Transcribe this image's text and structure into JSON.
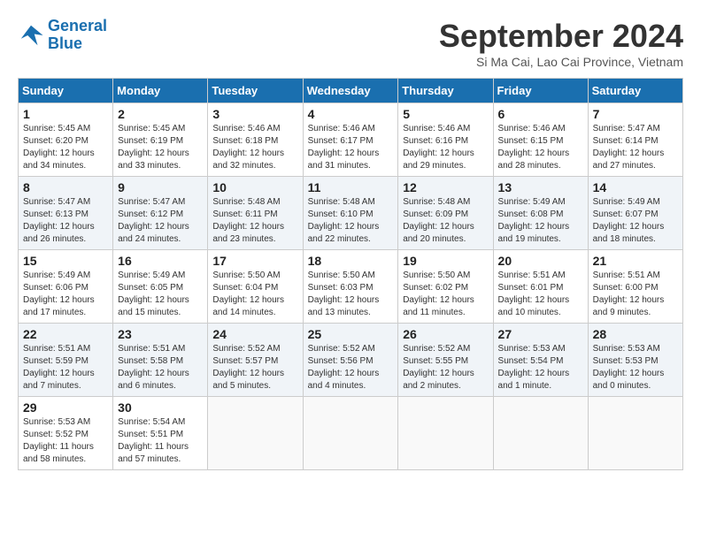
{
  "header": {
    "logo_line1": "General",
    "logo_line2": "Blue",
    "month": "September 2024",
    "location": "Si Ma Cai, Lao Cai Province, Vietnam"
  },
  "weekdays": [
    "Sunday",
    "Monday",
    "Tuesday",
    "Wednesday",
    "Thursday",
    "Friday",
    "Saturday"
  ],
  "weeks": [
    [
      {
        "day": "1",
        "info": "Sunrise: 5:45 AM\nSunset: 6:20 PM\nDaylight: 12 hours\nand 34 minutes."
      },
      {
        "day": "2",
        "info": "Sunrise: 5:45 AM\nSunset: 6:19 PM\nDaylight: 12 hours\nand 33 minutes."
      },
      {
        "day": "3",
        "info": "Sunrise: 5:46 AM\nSunset: 6:18 PM\nDaylight: 12 hours\nand 32 minutes."
      },
      {
        "day": "4",
        "info": "Sunrise: 5:46 AM\nSunset: 6:17 PM\nDaylight: 12 hours\nand 31 minutes."
      },
      {
        "day": "5",
        "info": "Sunrise: 5:46 AM\nSunset: 6:16 PM\nDaylight: 12 hours\nand 29 minutes."
      },
      {
        "day": "6",
        "info": "Sunrise: 5:46 AM\nSunset: 6:15 PM\nDaylight: 12 hours\nand 28 minutes."
      },
      {
        "day": "7",
        "info": "Sunrise: 5:47 AM\nSunset: 6:14 PM\nDaylight: 12 hours\nand 27 minutes."
      }
    ],
    [
      {
        "day": "8",
        "info": "Sunrise: 5:47 AM\nSunset: 6:13 PM\nDaylight: 12 hours\nand 26 minutes."
      },
      {
        "day": "9",
        "info": "Sunrise: 5:47 AM\nSunset: 6:12 PM\nDaylight: 12 hours\nand 24 minutes."
      },
      {
        "day": "10",
        "info": "Sunrise: 5:48 AM\nSunset: 6:11 PM\nDaylight: 12 hours\nand 23 minutes."
      },
      {
        "day": "11",
        "info": "Sunrise: 5:48 AM\nSunset: 6:10 PM\nDaylight: 12 hours\nand 22 minutes."
      },
      {
        "day": "12",
        "info": "Sunrise: 5:48 AM\nSunset: 6:09 PM\nDaylight: 12 hours\nand 20 minutes."
      },
      {
        "day": "13",
        "info": "Sunrise: 5:49 AM\nSunset: 6:08 PM\nDaylight: 12 hours\nand 19 minutes."
      },
      {
        "day": "14",
        "info": "Sunrise: 5:49 AM\nSunset: 6:07 PM\nDaylight: 12 hours\nand 18 minutes."
      }
    ],
    [
      {
        "day": "15",
        "info": "Sunrise: 5:49 AM\nSunset: 6:06 PM\nDaylight: 12 hours\nand 17 minutes."
      },
      {
        "day": "16",
        "info": "Sunrise: 5:49 AM\nSunset: 6:05 PM\nDaylight: 12 hours\nand 15 minutes."
      },
      {
        "day": "17",
        "info": "Sunrise: 5:50 AM\nSunset: 6:04 PM\nDaylight: 12 hours\nand 14 minutes."
      },
      {
        "day": "18",
        "info": "Sunrise: 5:50 AM\nSunset: 6:03 PM\nDaylight: 12 hours\nand 13 minutes."
      },
      {
        "day": "19",
        "info": "Sunrise: 5:50 AM\nSunset: 6:02 PM\nDaylight: 12 hours\nand 11 minutes."
      },
      {
        "day": "20",
        "info": "Sunrise: 5:51 AM\nSunset: 6:01 PM\nDaylight: 12 hours\nand 10 minutes."
      },
      {
        "day": "21",
        "info": "Sunrise: 5:51 AM\nSunset: 6:00 PM\nDaylight: 12 hours\nand 9 minutes."
      }
    ],
    [
      {
        "day": "22",
        "info": "Sunrise: 5:51 AM\nSunset: 5:59 PM\nDaylight: 12 hours\nand 7 minutes."
      },
      {
        "day": "23",
        "info": "Sunrise: 5:51 AM\nSunset: 5:58 PM\nDaylight: 12 hours\nand 6 minutes."
      },
      {
        "day": "24",
        "info": "Sunrise: 5:52 AM\nSunset: 5:57 PM\nDaylight: 12 hours\nand 5 minutes."
      },
      {
        "day": "25",
        "info": "Sunrise: 5:52 AM\nSunset: 5:56 PM\nDaylight: 12 hours\nand 4 minutes."
      },
      {
        "day": "26",
        "info": "Sunrise: 5:52 AM\nSunset: 5:55 PM\nDaylight: 12 hours\nand 2 minutes."
      },
      {
        "day": "27",
        "info": "Sunrise: 5:53 AM\nSunset: 5:54 PM\nDaylight: 12 hours\nand 1 minute."
      },
      {
        "day": "28",
        "info": "Sunrise: 5:53 AM\nSunset: 5:53 PM\nDaylight: 12 hours\nand 0 minutes."
      }
    ],
    [
      {
        "day": "29",
        "info": "Sunrise: 5:53 AM\nSunset: 5:52 PM\nDaylight: 11 hours\nand 58 minutes."
      },
      {
        "day": "30",
        "info": "Sunrise: 5:54 AM\nSunset: 5:51 PM\nDaylight: 11 hours\nand 57 minutes."
      },
      {
        "day": "",
        "info": ""
      },
      {
        "day": "",
        "info": ""
      },
      {
        "day": "",
        "info": ""
      },
      {
        "day": "",
        "info": ""
      },
      {
        "day": "",
        "info": ""
      }
    ]
  ]
}
